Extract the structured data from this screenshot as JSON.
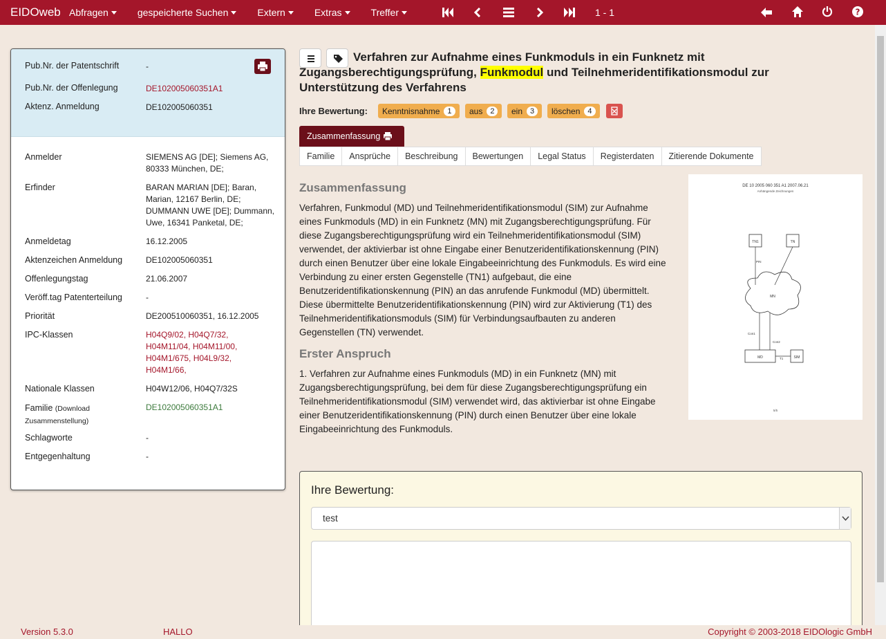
{
  "nav": {
    "brand": "EIDOweb",
    "menus": [
      "Abfragen",
      "gespeicherte Suchen",
      "Extern",
      "Extras",
      "Treffer"
    ],
    "pager": "1 - 1"
  },
  "left": {
    "top_rows": [
      {
        "label": "Pub.Nr. der Patentschrift",
        "value": "-"
      },
      {
        "label": "Pub.Nr. der Offenlegung",
        "value": "DE102005060351A1"
      },
      {
        "label": "Aktenz. Anmeldung",
        "value": "DE102005060351"
      }
    ],
    "anmelder_label": "Anmelder",
    "anmelder_value": "SIEMENS AG [DE]; Siemens AG, 80333 München, DE;",
    "erfinder_label": "Erfinder",
    "erfinder_value": "BARAN MARIAN [DE]; Baran, Marian, 12167 Berlin, DE; DUMMANN UWE [DE]; Dummann, Uwe, 16341 Panketal, DE;",
    "anmeldetag_label": "Anmeldetag",
    "anmeldetag_value": "16.12.2005",
    "aktenz_label": "Aktenzeichen Anmeldung",
    "aktenz_value": "DE102005060351",
    "offenlegungstag_label": "Offenlegungstag",
    "offenlegungstag_value": "21.06.2007",
    "patenterteilung_label": "Veröff.tag Patenterteilung",
    "patenterteilung_value": "-",
    "prioritaet_label": "Priorität",
    "prioritaet_value": "DE200510060351, 16.12.2005",
    "ipc_label": "IPC-Klassen",
    "ipc_values": [
      "H04Q9/02,",
      "H04Q7/32,",
      "H04M11/04,",
      "H04M11/00,",
      "H04M1/675,",
      "H04L9/32,",
      "H04M1/66,"
    ],
    "nationale_label": "Nationale Klassen",
    "nationale_value": "H04W12/06, H04Q7/32S",
    "familie_label": "Familie",
    "familie_sub": "(Download Zusammenstellung)",
    "familie_value": "DE102005060351A1",
    "schlagworte_label": "Schlagworte",
    "schlagworte_value": "-",
    "entgegen_label": "Entgegenhaltung",
    "entgegen_value": "-"
  },
  "main": {
    "title_part1": "Verfahren zur Aufnahme eines Funkmoduls in ein Funknetz mit",
    "title_part2": "Zugangsberechtigungsprüfung,",
    "title_highlight": "Funkmodul",
    "title_part3": "und Teilnehmeridentifikationsmodul zur",
    "title_part4": "Unterstützung des Verfahrens",
    "rating_label": "Ihre Bewertung:",
    "rating_buttons": [
      {
        "label": "Kenntnisnahme",
        "count": "1"
      },
      {
        "label": "aus",
        "count": "2"
      },
      {
        "label": "ein",
        "count": "3"
      },
      {
        "label": "löschen",
        "count": "4"
      }
    ],
    "active_tab": "Zusammenfassung",
    "tabs": [
      "Familie",
      "Ansprüche",
      "Beschreibung",
      "Bewertungen",
      "Legal Status",
      "Registerdaten",
      "Zitierende Dokumente"
    ],
    "summary_heading": "Zusammenfassung",
    "summary_text": "Verfahren, Funkmodul (MD) und Teilnehmeridentifikationsmodul (SIM) zur Aufnahme eines Funkmoduls (MD) in ein Funknetz (MN) mit Zugangsberechtigungsprüfung. Für diese Zugangsberechtigungsprüfung wird ein Teilnehmeridentifikationsmodul (SIM) verwendet, der aktivierbar ist ohne Eingabe einer Benutzeridentifikationskennung (PIN) durch einen Benutzer über eine lokale Eingabeeinrichtung des Funkmoduls. Es wird eine Verbindung zu einer ersten Gegenstelle (TN1) aufgebaut, die eine Benutzeridentifikationskennung (PIN) an das anrufende Funkmodul (MD) übermittelt. Diese übermittelte Benutzeridentifikationskennung (PIN) wird zur Aktivierung (T1) des Teilnehmeridentifikationsmoduls (SIM) für Verbindungsaufbauten zu anderen Gegenstellen (TN) verwendet.",
    "claim_heading": "Erster Anspruch",
    "claim_text": "1. Verfahren zur Aufnahme eines Funkmoduls (MD) in ein Funknetz (MN) mit Zugangsberechtigungsprüfung, bei dem für diese Zugangsberechtigungsprüfung ein Teilnehmeridentifikationsmodul (SIM) verwendet wird, das aktivierbar ist ohne Eingabe einer Benutzeridentifikationskennung (PIN) durch einen Benutzer über eine lokale Eingabeeinrichtung des Funkmoduls.",
    "drawing": {
      "header": "DE 10 2005 060 351 A1     2007.06.21",
      "subheader": "Anhängende Zeichnungen",
      "labels": [
        "TN1",
        "TN",
        "MN",
        "MD",
        "SIM",
        "Con1",
        "Con2",
        "PIN",
        "T1"
      ],
      "page": "5/5"
    }
  },
  "rating_panel": {
    "heading": "Ihre Bewertung:",
    "select_value": "test"
  },
  "footer": {
    "version": "Version 5.3.0",
    "user": "HALLO",
    "copyright": "Copyright © 2003-2018 EIDOlogic GmbH"
  }
}
